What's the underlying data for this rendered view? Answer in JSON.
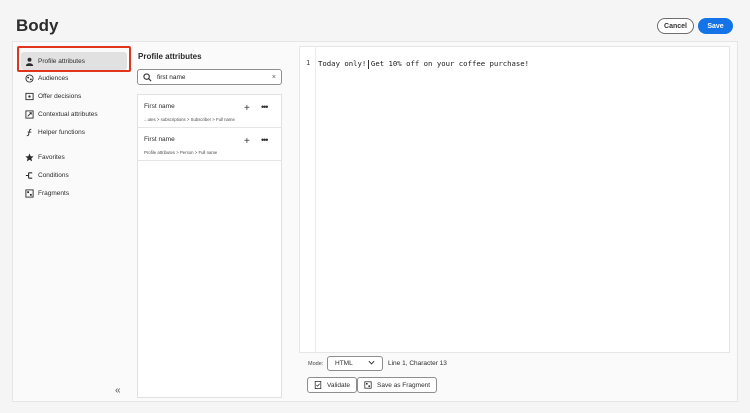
{
  "header": {
    "title": "Body",
    "cancel_label": "Cancel",
    "save_label": "Save"
  },
  "nav": {
    "items": [
      {
        "label": "Profile attributes",
        "icon": "person-icon"
      },
      {
        "label": "Audiences",
        "icon": "audiences-icon"
      },
      {
        "label": "Offer decisions",
        "icon": "offer-icon"
      },
      {
        "label": "Contextual attributes",
        "icon": "contextual-icon"
      },
      {
        "label": "Helper functions",
        "icon": "function-icon"
      },
      {
        "label": "Favorites",
        "icon": "star-icon"
      },
      {
        "label": "Conditions",
        "icon": "conditions-icon"
      },
      {
        "label": "Fragments",
        "icon": "fragments-icon"
      }
    ],
    "collapse_glyph": "«"
  },
  "panel": {
    "title": "Profile attributes",
    "search_value": "first name",
    "clear_glyph": "×",
    "results": [
      {
        "name": "First name",
        "path": "...utes > subscriptions > Subscriber > Full name"
      },
      {
        "name": "First name",
        "path": "Profile attributes > Person > Full name"
      }
    ],
    "add_glyph": "+",
    "more_glyph": "•••"
  },
  "editor": {
    "line_number": "1",
    "code_before": "Today only!",
    "code_after": "Get 10% off on your coffee purchase!",
    "mode_label": "Mode:",
    "mode_value": "HTML",
    "position": "Line 1, Character 13",
    "validate_label": "Validate",
    "save_fragment_label": "Save as Fragment"
  },
  "colors": {
    "accent": "#1473e6",
    "highlight": "#e0341c"
  }
}
